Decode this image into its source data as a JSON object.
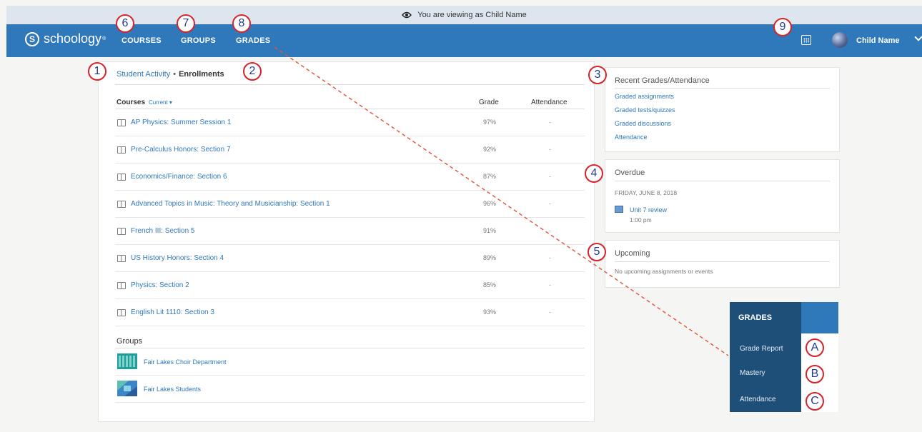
{
  "banner": {
    "text": "You are viewing as Child Name",
    "icon": "eye-icon"
  },
  "nav": {
    "logo_text": "schoology",
    "logo_mark": "S",
    "logo_tm": "®",
    "links": {
      "courses": "COURSES",
      "groups": "GROUPS",
      "grades": "GRADES"
    },
    "user_name": "Child Name",
    "bg_color": "#2f78b9"
  },
  "breadcrumb": {
    "link": "Student Activity",
    "separator": "•",
    "current": "Enrollments"
  },
  "courses_table": {
    "headers": {
      "courses": "Courses",
      "filter": "Current ▾",
      "grade": "Grade",
      "attendance": "Attendance"
    },
    "rows": [
      {
        "name": "AP Physics: Summer Session 1",
        "grade": "97%",
        "attendance": "-"
      },
      {
        "name": "Pre-Calculus Honors: Section 7",
        "grade": "92%",
        "attendance": "-"
      },
      {
        "name": "Economics/Finance: Section 6",
        "grade": "87%",
        "attendance": "-"
      },
      {
        "name": "Advanced Topics in Music: Theory and Musicianship: Section 1",
        "grade": "96%",
        "attendance": "-"
      },
      {
        "name": "French III: Section 5",
        "grade": "91%",
        "attendance": "-"
      },
      {
        "name": "US History Honors: Section 4",
        "grade": "89%",
        "attendance": "-"
      },
      {
        "name": "Physics: Section 2",
        "grade": "85%",
        "attendance": "-"
      },
      {
        "name": "English Lit 1110: Section 3",
        "grade": "93%",
        "attendance": "-"
      }
    ]
  },
  "groups": {
    "title": "Groups",
    "items": [
      {
        "name": "Fair Lakes Choir Department"
      },
      {
        "name": "Fair Lakes Students"
      }
    ]
  },
  "recent_grades": {
    "title": "Recent Grades/Attendance",
    "links": [
      "Graded assignments",
      "Graded tests/quizzes",
      "Graded discussions",
      "Attendance"
    ]
  },
  "overdue": {
    "title": "Overdue",
    "date": "FRIDAY, JUNE 8, 2018",
    "item_name": "Unit 7 review",
    "item_time": "1:00 pm"
  },
  "upcoming": {
    "title": "Upcoming",
    "empty_text": "No upcoming assignments or events"
  },
  "grades_menu": {
    "header": "GRADES",
    "items": [
      "Grade Report",
      "Mastery",
      "Attendance"
    ]
  },
  "callouts": {
    "numbers": [
      "1",
      "2",
      "3",
      "4",
      "5",
      "6",
      "7",
      "8",
      "9"
    ],
    "letters": [
      "A",
      "B",
      "C"
    ],
    "color": "#d8232a"
  }
}
